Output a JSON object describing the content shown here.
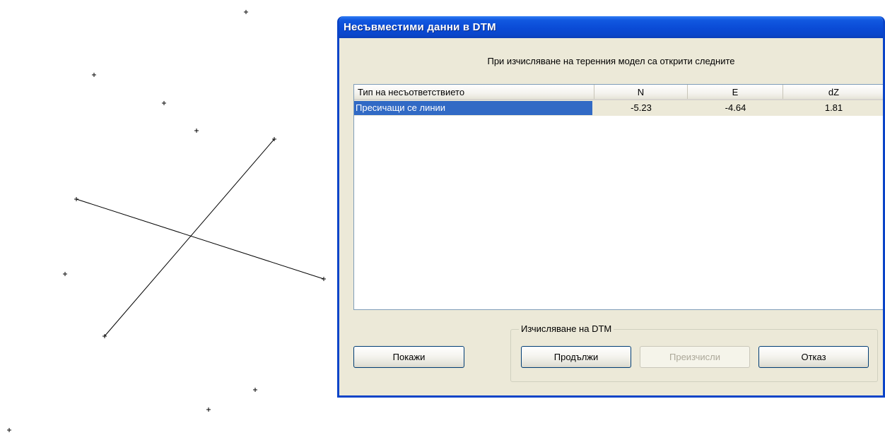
{
  "window": {
    "title": "Несъвместими данни в DTM"
  },
  "prompt": "При изчисляване на теренния модел са открити следните",
  "table": {
    "columns": [
      "Тип на несъответствието",
      "N",
      "E",
      "dZ"
    ],
    "rows": [
      {
        "type": "Пресичащи се линии",
        "n": "-5.23",
        "e": "-4.64",
        "dz": "1.81",
        "selected": true
      }
    ]
  },
  "group": {
    "label": "Изчисляване на DTM"
  },
  "buttons": {
    "show": "Покажи",
    "continue": "Продължи",
    "recalculate": "Преизчисли",
    "cancel": "Отказ"
  },
  "colors": {
    "titlebar": "#0a4bd6",
    "selection": "#316ac5",
    "dialog_bg": "#ece9d8"
  }
}
